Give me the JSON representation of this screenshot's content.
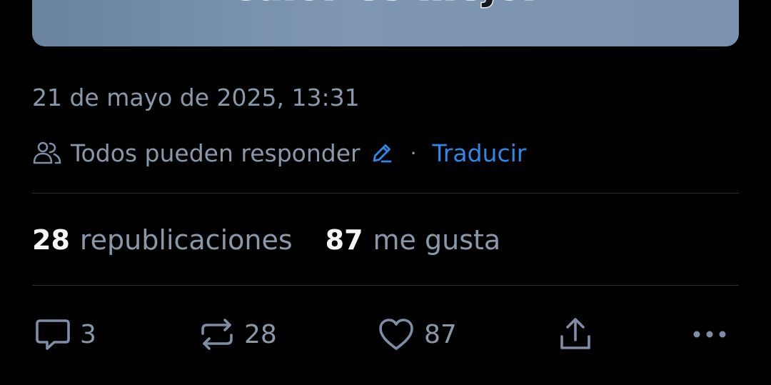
{
  "image_card": {
    "caption": "Calor es mejor"
  },
  "post": {
    "timestamp": "21 de mayo de 2025, 13:31",
    "reply_permission": "Todos pueden responder",
    "separator": "·",
    "translate_label": "Traducir"
  },
  "stats": {
    "reposts_count": "28",
    "reposts_label": "republicaciones",
    "likes_count": "87",
    "likes_label": "me gusta"
  },
  "actions": {
    "reply_count": "3",
    "repost_count": "28",
    "like_count": "87"
  },
  "icons": {
    "reply_permission": "people-icon",
    "edit": "pencil-icon",
    "reply": "speech-bubble-icon",
    "repost": "repost-arrows-icon",
    "like": "heart-icon",
    "share": "share-upload-icon",
    "more": "ellipsis-icon"
  },
  "colors": {
    "background": "#000000",
    "muted_text": "#8b98a9",
    "primary_text": "#f3f5f7",
    "accent": "#2f88e8",
    "divider": "#2a2f36"
  }
}
